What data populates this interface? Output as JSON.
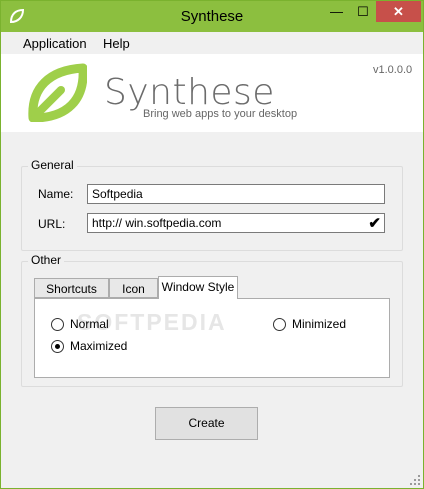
{
  "window": {
    "title": "Synthese",
    "minimize_glyph": "—",
    "maximize_glyph": "☐",
    "close_glyph": "✕"
  },
  "menu": {
    "items": [
      {
        "label": "Application"
      },
      {
        "label": "Help"
      }
    ]
  },
  "banner": {
    "app_name": "Synthese",
    "tagline": "Bring web apps to your desktop",
    "version": "v1.0.0.0",
    "logo_icon": "leaf-icon"
  },
  "general": {
    "legend": "General",
    "name_label": "Name:",
    "name_value": "Softpedia",
    "url_label": "URL:",
    "url_value": "http:// win.softpedia.com",
    "url_valid_glyph": "✔"
  },
  "other": {
    "legend": "Other",
    "tabs": [
      {
        "label": "Shortcuts",
        "selected": false
      },
      {
        "label": "Icon",
        "selected": false
      },
      {
        "label": "Window Style",
        "selected": true
      }
    ],
    "window_style": {
      "options": [
        {
          "label": "Normal",
          "selected": false
        },
        {
          "label": "Minimized",
          "selected": false
        },
        {
          "label": "Maximized",
          "selected": true
        }
      ]
    },
    "watermark": "SOFTPEDIA"
  },
  "create_button": {
    "label": "Create"
  },
  "colors": {
    "titlebar": "#8cbf3f",
    "close": "#c7504a",
    "logo": "#9fcf4a"
  }
}
